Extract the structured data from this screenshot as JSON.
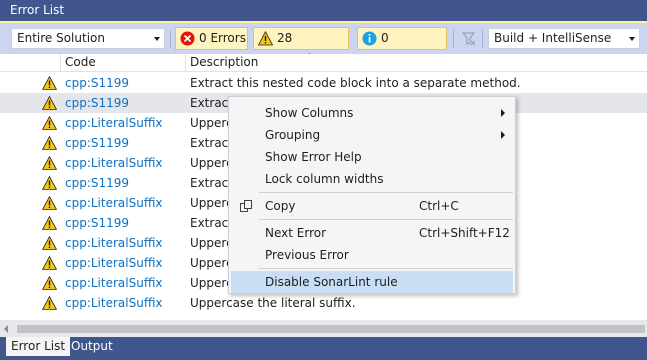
{
  "window": {
    "title": "Error List"
  },
  "toolbar": {
    "scope_value": "Entire Solution",
    "errors_label": "0 Errors",
    "warnings_label": "28 Warnings",
    "messages_label": "0 Messages",
    "build_value": "Build + IntelliSense"
  },
  "columns": {
    "code": "Code",
    "description": "Description"
  },
  "rows": [
    {
      "code": "cpp:S1199",
      "description": "Extract this nested code block into a separate method."
    },
    {
      "code": "cpp:S1199",
      "description": "Extract"
    },
    {
      "code": "cpp:LiteralSuffix",
      "description": "Upperc"
    },
    {
      "code": "cpp:S1199",
      "description": "Extract"
    },
    {
      "code": "cpp:LiteralSuffix",
      "description": "Upperc"
    },
    {
      "code": "cpp:S1199",
      "description": "Extract"
    },
    {
      "code": "cpp:LiteralSuffix",
      "description": "Upperc"
    },
    {
      "code": "cpp:S1199",
      "description": "Extract"
    },
    {
      "code": "cpp:LiteralSuffix",
      "description": "Upperc"
    },
    {
      "code": "cpp:LiteralSuffix",
      "description": "Upperc"
    },
    {
      "code": "cpp:LiteralSuffix",
      "description": "Upperc"
    },
    {
      "code": "cpp:LiteralSuffix",
      "description": "Uppercase the literal suffix."
    }
  ],
  "context_menu": {
    "show_columns": "Show Columns",
    "grouping": "Grouping",
    "show_error_help": "Show Error Help",
    "lock_column_widths": "Lock column widths",
    "copy": "Copy",
    "copy_shortcut": "Ctrl+C",
    "next_error": "Next Error",
    "next_error_shortcut": "Ctrl+Shift+F12",
    "previous_error": "Previous Error",
    "disable_rule": "Disable SonarLint rule"
  },
  "tabs": {
    "error_list": "Error List",
    "output": "Output"
  },
  "colors": {
    "title_bar": "#40568D",
    "toolbar": "#CCD5F0",
    "link_blue": "#0E70C0",
    "warning_yellow": "#F5C518",
    "error_red": "#E51400",
    "info_blue": "#1BA1E2",
    "menu_highlight": "#C9DEF5"
  }
}
